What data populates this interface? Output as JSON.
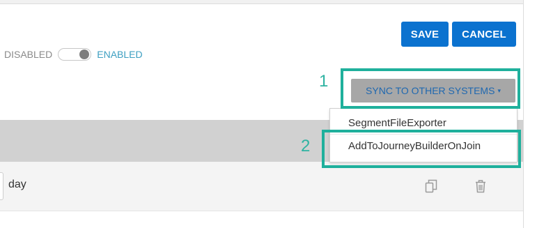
{
  "toolbar": {
    "save_label": "SAVE",
    "cancel_label": "CANCEL"
  },
  "status_toggle": {
    "off_label": "DISABLED",
    "on_label": "ENABLED",
    "enabled": true
  },
  "sync": {
    "button_label": "SYNC TO OTHER SYSTEMS",
    "caret": "▾",
    "menu_items": [
      {
        "label": "SegmentFileExporter"
      },
      {
        "label": "AddToJourneyBuilderOnJoin"
      }
    ]
  },
  "callouts": [
    {
      "number": "1"
    },
    {
      "number": "2"
    }
  ],
  "row": {
    "unit_value": "day"
  },
  "icons": {
    "copy": "copy-icon",
    "delete": "trash-icon"
  },
  "colors": {
    "primary_button": "#0b72cf",
    "callout_accent": "#1fb09c",
    "enabled_text": "#3d9fc1",
    "sync_button_bg": "#a7a7a7"
  }
}
